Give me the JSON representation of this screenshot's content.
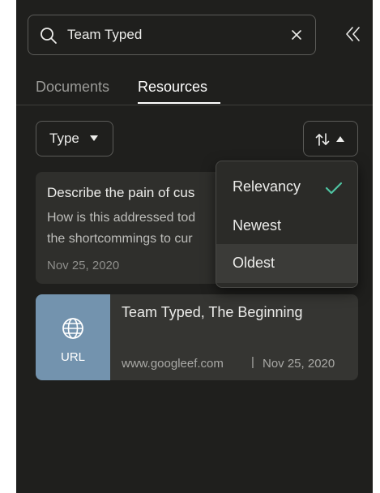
{
  "search": {
    "value": "Team Typed"
  },
  "tabs": [
    {
      "label": "Documents",
      "active": false
    },
    {
      "label": "Resources",
      "active": true
    }
  ],
  "filters": {
    "type_label": "Type"
  },
  "sort_menu": {
    "items": [
      {
        "label": "Relevancy",
        "selected": true
      },
      {
        "label": "Newest",
        "selected": false
      },
      {
        "label": "Oldest",
        "selected": false
      }
    ]
  },
  "cards": [
    {
      "title": "Describe the pain of cus",
      "line1": "How is this addressed tod",
      "line2": "the shortcommings to cur",
      "date": "Nov 25, 2020"
    },
    {
      "type": "URL",
      "title": "Team Typed, The Beginning",
      "url": "www.googleef.com",
      "separator": "|",
      "date": "Nov 25, 2020"
    }
  ],
  "colors": {
    "panel_bg": "#1f1f1d",
    "card_bg": "#2f2f2c",
    "thumb_bg": "#7393ae",
    "check": "#4fc3a1"
  }
}
